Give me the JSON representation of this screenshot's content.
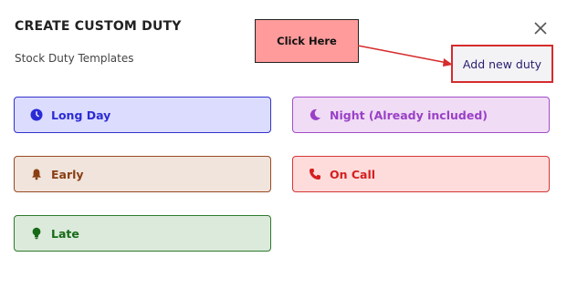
{
  "header": {
    "title": "CREATE CUSTOM DUTY",
    "subtitle": "Stock Duty Templates"
  },
  "annotation": {
    "callout_text": "Click Here"
  },
  "actions": {
    "add_label": "Add new duty"
  },
  "duties": [
    {
      "label": "Long Day",
      "icon": "clock-icon",
      "color": "#2b2bd6",
      "bg": "#dcdcff",
      "border": "#3333cc"
    },
    {
      "label": "Night (Already included)",
      "icon": "moon-icon",
      "color": "#9a40c7",
      "bg": "#f0dcf5",
      "border": "#a04dc8"
    },
    {
      "label": "Early",
      "icon": "bell-icon",
      "color": "#8a3e12",
      "bg": "#f0e4dc",
      "border": "#9a4a22"
    },
    {
      "label": "On Call",
      "icon": "phone-icon",
      "color": "#d41f1f",
      "bg": "#ffdcdc",
      "border": "#d43535"
    },
    {
      "label": "Late",
      "icon": "lightbulb-icon",
      "color": "#176b17",
      "bg": "#dceadc",
      "border": "#2d7a2d"
    }
  ]
}
